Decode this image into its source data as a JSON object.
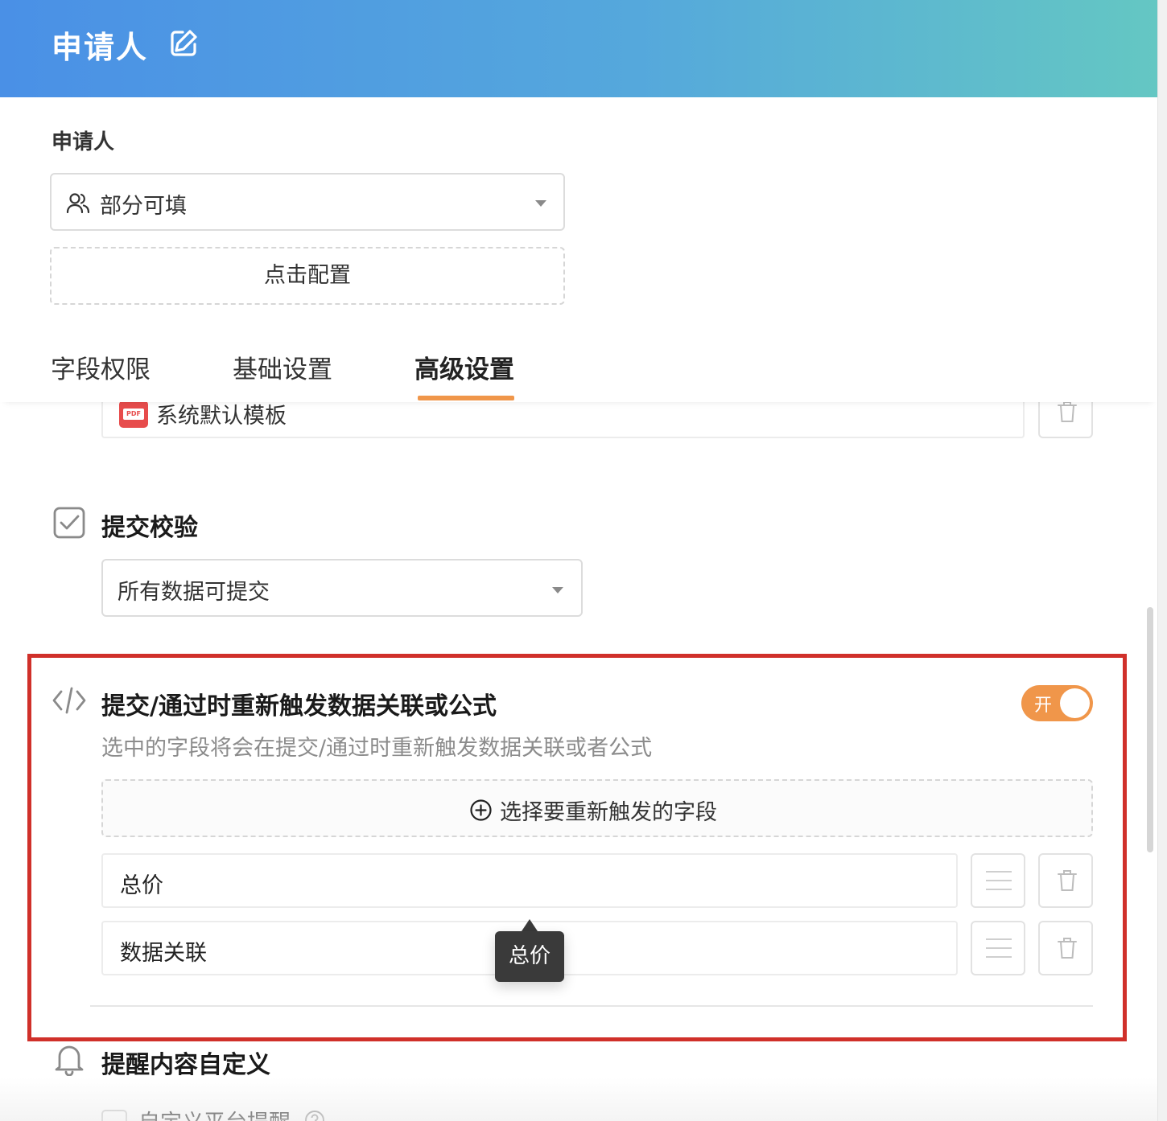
{
  "header": {
    "title": "申请人"
  },
  "field": {
    "label": "申请人",
    "permission_value": "部分可填",
    "config_label": "点击配置"
  },
  "tabs": [
    {
      "label": "字段权限"
    },
    {
      "label": "基础设置"
    },
    {
      "label": "高级设置",
      "active": true
    }
  ],
  "template": {
    "name": "系统默认模板",
    "icon_text": "PDF"
  },
  "submit_validation": {
    "title": "提交校验",
    "select_value": "所有数据可提交"
  },
  "retrigger": {
    "title": "提交/通过时重新触发数据关联或公式",
    "toggle_label": "开",
    "toggle_on": true,
    "description": "选中的字段将会在提交/通过时重新触发数据关联或者公式",
    "pick_label": "选择要重新触发的字段",
    "fields": [
      {
        "name": "总价"
      },
      {
        "name": "数据关联"
      }
    ],
    "tooltip": "总价"
  },
  "reminder": {
    "title": "提醒内容自定义",
    "custom_label": "自定义平台提醒"
  },
  "colors": {
    "accent": "#f0964a",
    "header_start": "#4a90e6",
    "header_end": "#64c7c3",
    "highlight": "#d0302a"
  }
}
